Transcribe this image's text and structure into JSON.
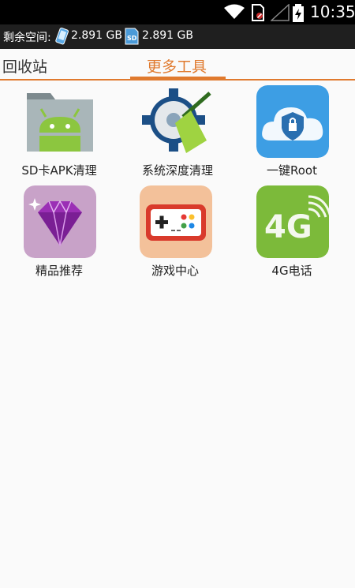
{
  "status_bar": {
    "time": "10:35"
  },
  "storage": {
    "label": "剩余空间:",
    "phone_value": "2.891 GB",
    "sd_value": "2.891 GB"
  },
  "tabs": [
    {
      "label": "回收站",
      "active": false
    },
    {
      "label": "更多工具",
      "active": true
    }
  ],
  "tools": [
    {
      "label": "SD卡APK清理",
      "icon": "android-folder-icon"
    },
    {
      "label": "系统深度清理",
      "icon": "gear-broom-icon"
    },
    {
      "label": "一键Root",
      "icon": "cloud-lock-icon"
    },
    {
      "label": "精品推荐",
      "icon": "diamond-icon"
    },
    {
      "label": "游戏中心",
      "icon": "gamepad-icon"
    },
    {
      "label": "4G电话",
      "icon": "4g-icon"
    }
  ],
  "colors": {
    "accent": "#e07a2e",
    "status_bg": "#000000",
    "storage_bg": "#1f1f1f"
  }
}
